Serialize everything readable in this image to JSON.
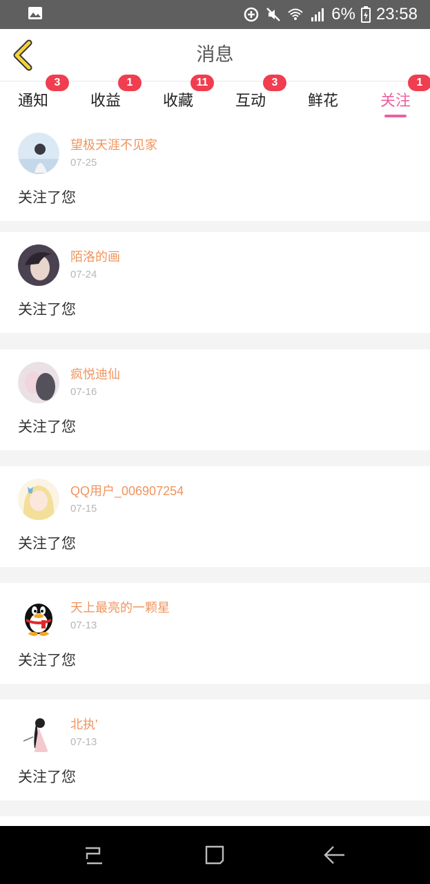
{
  "status_bar": {
    "battery": "6%",
    "time": "23:58"
  },
  "header": {
    "title": "消息"
  },
  "tabs": [
    {
      "label": "通知",
      "badge": "3"
    },
    {
      "label": "收益",
      "badge": "1"
    },
    {
      "label": "收藏",
      "badge": "11"
    },
    {
      "label": "互动",
      "badge": "3"
    },
    {
      "label": "鲜花",
      "badge": ""
    },
    {
      "label": "关注",
      "badge": "1",
      "active": true
    }
  ],
  "items": [
    {
      "name": "望极天涯不见家",
      "date": "07-25",
      "action": "关注了您"
    },
    {
      "name": "陌洛的画",
      "date": "07-24",
      "action": "关注了您"
    },
    {
      "name": "疯悦迪仙",
      "date": "07-16",
      "action": "关注了您"
    },
    {
      "name": "QQ用户_006907254",
      "date": "07-15",
      "action": "关注了您"
    },
    {
      "name": "天上最亮的一颗星",
      "date": "07-13",
      "action": "关注了您"
    },
    {
      "name": "北执ʹ",
      "date": "07-13",
      "action": "关注了您"
    }
  ],
  "colors": {
    "accent_pink": "#ee5f9e",
    "badge_red": "#f03d4f",
    "name_orange": "#f0945e",
    "back_arrow_yellow": "#f5d23b"
  }
}
